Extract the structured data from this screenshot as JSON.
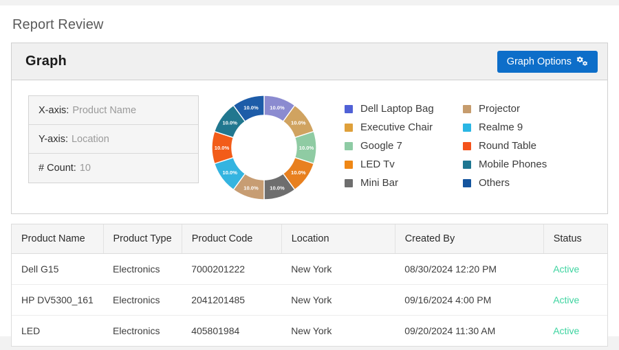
{
  "page": {
    "title": "Report Review"
  },
  "graph_panel": {
    "heading": "Graph",
    "options_button": {
      "label": "Graph Options",
      "icon": "gears-icon",
      "color": "#0d6ec9"
    },
    "axis_info": [
      {
        "key": "X-axis:",
        "value": "Product Name",
        "name": "x-axis"
      },
      {
        "key": "Y-axis:",
        "value": "Location",
        "name": "y-axis"
      },
      {
        "key": "# Count:",
        "value": "10",
        "name": "count"
      }
    ]
  },
  "chart_data": {
    "type": "pie",
    "variant": "donut",
    "title": "",
    "legend_position": "right",
    "legend_columns": 2,
    "value_format": "percent",
    "categories": [
      "Dell Laptop Bag",
      "Projector",
      "Google 7",
      "LED Tv",
      "Mini Bar",
      "Executive Chair",
      "Realme 9",
      "Round Table",
      "Mobile Phones",
      "Others"
    ],
    "slices": [
      {
        "label": "Dell Laptop Bag",
        "value": 10.0,
        "display": "10.0%",
        "color": "#8b8bd0"
      },
      {
        "label": "Projector",
        "value": 10.0,
        "display": "10.0%",
        "color": "#d0a360"
      },
      {
        "label": "Google 7",
        "value": 10.0,
        "display": "10.0%",
        "color": "#8fcba3"
      },
      {
        "label": "LED Tv",
        "value": 10.0,
        "display": "10.0%",
        "color": "#e8801f"
      },
      {
        "label": "Mini Bar",
        "value": 10.0,
        "display": "10.0%",
        "color": "#6e6e6e"
      },
      {
        "label": "Executive Chair",
        "value": 10.0,
        "display": "10.0%",
        "color": "#c79d73"
      },
      {
        "label": "Realme 9",
        "value": 10.0,
        "display": "10.0%",
        "color": "#34b4e0"
      },
      {
        "label": "Round Table",
        "value": 10.0,
        "display": "10.0%",
        "color": "#f25c19"
      },
      {
        "label": "Mobile Phones",
        "value": 10.0,
        "display": "10.0%",
        "color": "#21778f"
      },
      {
        "label": "Others",
        "value": 10.0,
        "display": "10.0%",
        "color": "#1d5ca8"
      }
    ],
    "legend": [
      {
        "label": "Dell Laptop Bag",
        "color": "#5061d6"
      },
      {
        "label": "Projector",
        "color": "#c69c6d"
      },
      {
        "label": "Executive Chair",
        "color": "#dfa03a"
      },
      {
        "label": "Realme 9",
        "color": "#2ab6e4"
      },
      {
        "label": "Google 7",
        "color": "#8ecba4"
      },
      {
        "label": "Round Table",
        "color": "#f4521b"
      },
      {
        "label": "LED Tv",
        "color": "#ef8715"
      },
      {
        "label": "Mobile Phones",
        "color": "#1e7691"
      },
      {
        "label": "Mini Bar",
        "color": "#6e6e6e"
      },
      {
        "label": "Others",
        "color": "#14549e"
      }
    ]
  },
  "table": {
    "columns": [
      "Product Name",
      "Product Type",
      "Product Code",
      "Location",
      "Created By",
      "Status"
    ],
    "rows": [
      {
        "product_name": "Dell G15",
        "product_type": "Electronics",
        "product_code": "7000201222",
        "location": "New York",
        "created_by": "08/30/2024 12:20 PM",
        "status": "Active"
      },
      {
        "product_name": "HP DV5300_161",
        "product_type": "Electronics",
        "product_code": "2041201485",
        "location": "New York",
        "created_by": "09/16/2024 4:00 PM",
        "status": "Active"
      },
      {
        "product_name": "LED",
        "product_type": "Electronics",
        "product_code": "405801984",
        "location": "New York",
        "created_by": "09/20/2024 11:30 AM",
        "status": "Active"
      }
    ],
    "status_color": "#3ed4a0"
  }
}
